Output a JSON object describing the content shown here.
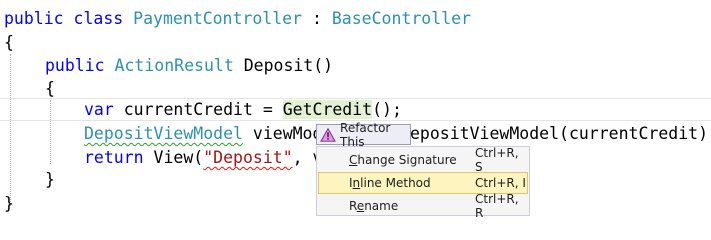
{
  "code": {
    "line1": {
      "kw1": "public",
      "kw2": "class",
      "name": "PaymentController",
      "sep": " : ",
      "base": "BaseController"
    },
    "line2": {
      "brace": "{"
    },
    "line3": {
      "kw": "public",
      "type": "ActionResult",
      "method": "Deposit()"
    },
    "line4": {
      "brace": "{"
    },
    "line5": {
      "kw": "var",
      "decl": " currentCredit = ",
      "call": "GetCredit",
      "rest": "();"
    },
    "line6": {
      "type": "DepositViewModel",
      "var": " viewMod",
      "rest": "epositViewModel(currentCredit);"
    },
    "line7": {
      "kw": "return",
      "pre": " View(",
      "str": "\"Deposit\"",
      "rest": ", v"
    },
    "line8": {
      "brace": "}"
    },
    "line9": {
      "brace": "}"
    }
  },
  "refactor": {
    "title": "Refactor This",
    "icon": "refactor-warning-icon",
    "items": [
      {
        "label": "Change Signature",
        "mnemonic_index": 0,
        "shortcut": "Ctrl+R, S"
      },
      {
        "label": "Inline Method",
        "mnemonic_index": 1,
        "shortcut": "Ctrl+R, I",
        "selected": true
      },
      {
        "label": "Rename",
        "mnemonic_index": 1,
        "shortcut": "Ctrl+R, R"
      }
    ]
  },
  "colors": {
    "keyword": "#0000ff",
    "type": "#2b91af",
    "string": "#a31515",
    "highlight": "#e4f0d2",
    "selected_item": "#fdf4bf",
    "icon_fill": "#e895ef"
  }
}
